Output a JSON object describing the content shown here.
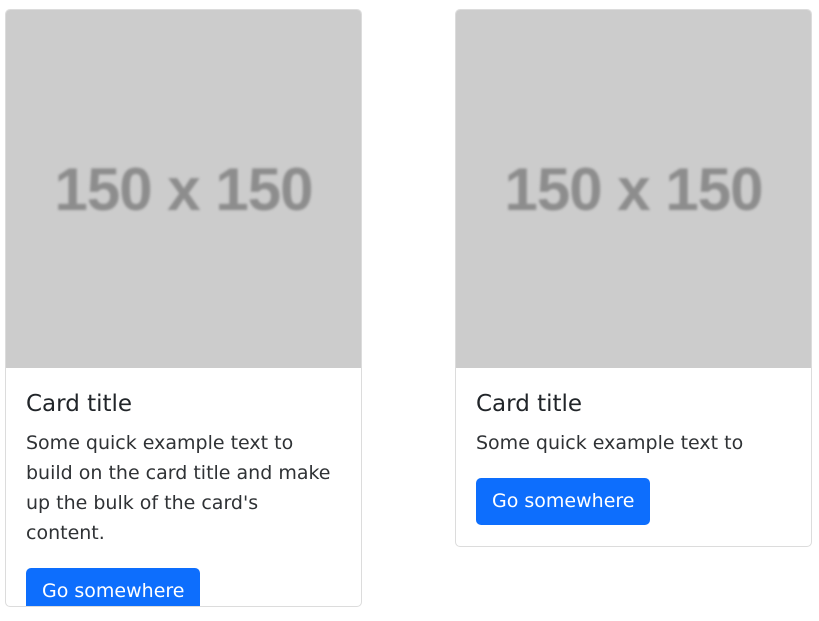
{
  "cards": [
    {
      "image_label": "150 x 150",
      "title": "Card title",
      "text": "Some quick example text to build on the card title and make up the bulk of the card's content.",
      "button_label": "Go somewhere"
    },
    {
      "image_label": "150 x 150",
      "title": "Card title",
      "text": "Some quick example text to",
      "button_label": "Go somewhere"
    }
  ],
  "colors": {
    "primary": "#0d6efd",
    "placeholder_bg": "#cccccc",
    "placeholder_text": "#8d8d8d",
    "border": "#dcdcdc"
  }
}
